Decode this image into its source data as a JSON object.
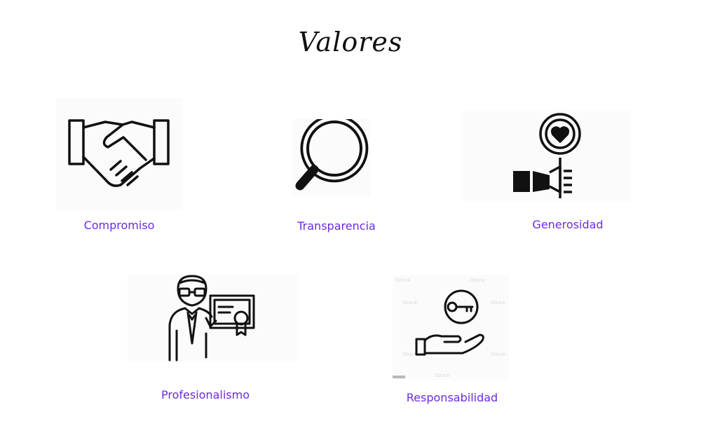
{
  "page": {
    "title": "Valores"
  },
  "values": [
    {
      "label": "Compromiso",
      "icon": "handshake-icon"
    },
    {
      "label": "Transparencia",
      "icon": "magnifying-glass-icon"
    },
    {
      "label": "Generosidad",
      "icon": "heart-donation-icon"
    },
    {
      "label": "Profesionalismo",
      "icon": "professional-certificate-icon"
    },
    {
      "label": "Responsabilidad",
      "icon": "hand-key-icon"
    }
  ],
  "colors": {
    "label": "#6a2be0",
    "icon_stroke": "#111111",
    "background": "#ffffff"
  }
}
